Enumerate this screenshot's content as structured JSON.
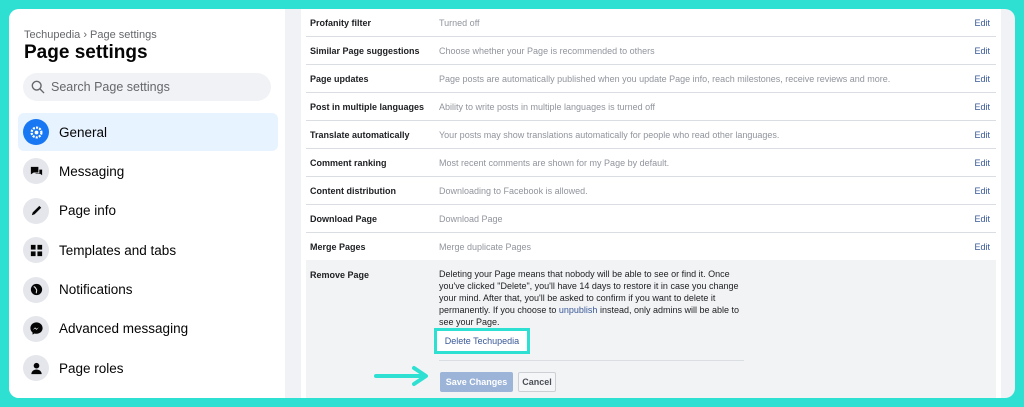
{
  "sidebar": {
    "breadcrumb": "Techupedia › Page settings",
    "title": "Page settings",
    "search_placeholder": "Search Page settings",
    "items": [
      {
        "label": "General",
        "icon": "gear-icon",
        "active": true
      },
      {
        "label": "Messaging",
        "icon": "chat-bubbles-icon"
      },
      {
        "label": "Page info",
        "icon": "pencil-icon"
      },
      {
        "label": "Templates and tabs",
        "icon": "grid-icon"
      },
      {
        "label": "Notifications",
        "icon": "globe-icon"
      },
      {
        "label": "Advanced messaging",
        "icon": "messenger-icon"
      },
      {
        "label": "Page roles",
        "icon": "person-icon"
      }
    ]
  },
  "settings": {
    "edit_label": "Edit",
    "rows": [
      {
        "label": "Profanity filter",
        "value": "Turned off"
      },
      {
        "label": "Similar Page suggestions",
        "value": "Choose whether your Page is recommended to others"
      },
      {
        "label": "Page updates",
        "value": "Page posts are automatically published when you update Page info, reach milestones, receive reviews and more."
      },
      {
        "label": "Post in multiple languages",
        "value": "Ability to write posts in multiple languages is turned off"
      },
      {
        "label": "Translate automatically",
        "value": "Your posts may show translations automatically for people who read other languages."
      },
      {
        "label": "Comment ranking",
        "value": "Most recent comments are shown for my Page by default."
      },
      {
        "label": "Content distribution",
        "value": "Downloading to Facebook is allowed."
      },
      {
        "label": "Download Page",
        "value": "Download Page"
      },
      {
        "label": "Merge Pages",
        "value": "Merge duplicate Pages"
      }
    ],
    "remove_page": {
      "label": "Remove Page",
      "desc_before": "Deleting your Page means that nobody will be able to see or find it. Once you've clicked \"Delete\", you'll have 14 days to restore it in case you change your mind. After that, you'll be asked to confirm if you want to delete it permanently. If you choose to ",
      "unpublish_link": "unpublish",
      "desc_after": " instead, only admins will be able to see your Page.",
      "delete_link": "Delete Techupedia",
      "save_label": "Save Changes",
      "cancel_label": "Cancel"
    }
  },
  "colors": {
    "highlight": "#2ee0d2",
    "fb_blue": "#1877f2",
    "link": "#385898"
  }
}
